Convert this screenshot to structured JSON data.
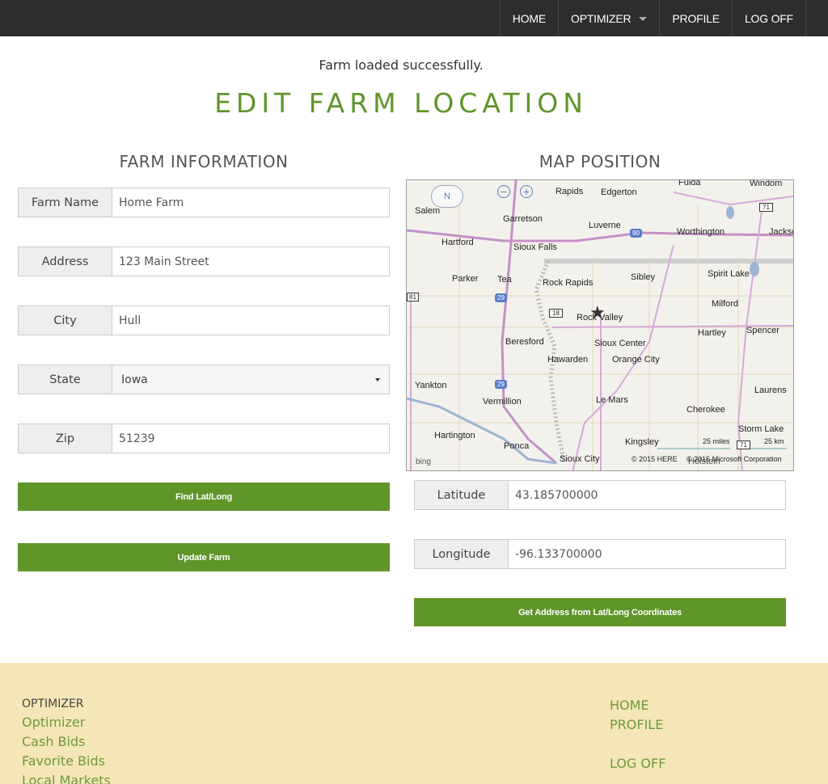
{
  "nav": {
    "items": [
      {
        "label": "HOME"
      },
      {
        "label": "OPTIMIZER"
      },
      {
        "label": "PROFILE"
      },
      {
        "label": "LOG OFF"
      }
    ]
  },
  "status_message": "Farm loaded successfully.",
  "page_title": "EDIT FARM LOCATION",
  "farm_info": {
    "title": "FARM INFORMATION",
    "farm_name": {
      "label": "Farm Name",
      "value": "Home Farm"
    },
    "address": {
      "label": "Address",
      "value": "123 Main Street"
    },
    "city": {
      "label": "City",
      "value": "Hull"
    },
    "state": {
      "label": "State",
      "value": "Iowa"
    },
    "zip": {
      "label": "Zip",
      "value": "51239"
    },
    "find_button": "Find Lat/Long",
    "update_button": "Update Farm"
  },
  "map_position": {
    "title": "MAP POSITION",
    "latitude": {
      "label": "Latitude",
      "value": "43.185700000"
    },
    "longitude": {
      "label": "Longitude",
      "value": "-96.133700000"
    },
    "get_address_button": "Get Address from Lat/Long Coordinates"
  },
  "map": {
    "labels": {
      "rapids_top": "Rapids",
      "edgerton": "Edgerton",
      "fulda": "Fulda",
      "windom": "Windom",
      "salem": "Salem",
      "garretson": "Garretson",
      "luverne": "Luverne",
      "hartford": "Hartford",
      "worthington": "Worthington",
      "jackson": "Jackso",
      "sioux_falls": "Sioux Falls",
      "parker": "Parker",
      "tea": "Tea",
      "rock_rapids": "Rock Rapids",
      "sibley": "Sibley",
      "spirit_lake": "Spirit Lake",
      "milford": "Milford",
      "rock_valley": "Rock Valley",
      "hartley": "Hartley",
      "spencer": "Spencer",
      "beresford": "Beresford",
      "sioux_center": "Sioux Center",
      "hawarden": "Hawarden",
      "orange_city": "Orange City",
      "yankton": "Yankton",
      "vermillion": "Vermillion",
      "le_mars": "Le Mars",
      "laurens": "Laurens",
      "cherokee": "Cherokee",
      "hartington": "Hartington",
      "storm_lake": "Storm Lake",
      "ponca": "Ponca",
      "kingsley": "Kingsley",
      "sioux_city": "Sioux City",
      "holstein": "Holstein"
    },
    "shields": {
      "i90": "90",
      "i29a": "29",
      "i29b": "29",
      "us18": "18",
      "us71a": "71",
      "us71b": "71",
      "us81": "81"
    },
    "compass": "N",
    "scale_miles": "25 miles",
    "scale_km": "25 km",
    "bing": "bing",
    "copyright_here": "© 2015 HERE",
    "copyright_ms": "© 2015 Microsoft Corporation"
  },
  "footer": {
    "heading": "OPTIMIZER",
    "left_links": [
      "Optimizer",
      "Cash Bids",
      "Favorite Bids",
      "Local Markets"
    ],
    "right_links": [
      "HOME",
      "PROFILE",
      "LOG OFF"
    ]
  },
  "colors": {
    "accent": "#5f9529",
    "nav_bg": "#2d2d2d",
    "footer_bg": "#f4e6b6"
  }
}
